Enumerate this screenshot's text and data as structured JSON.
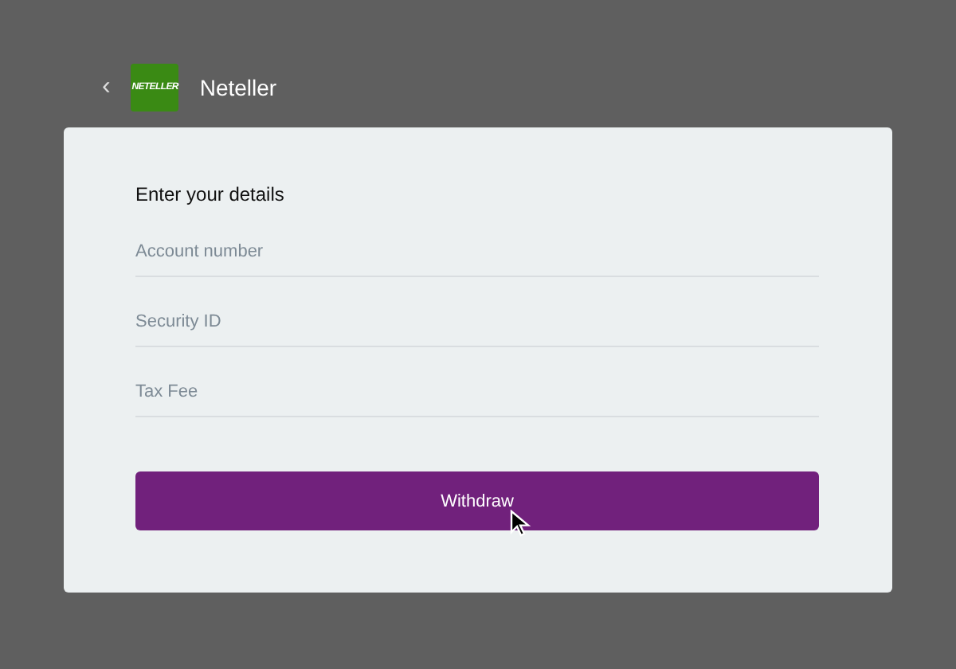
{
  "header": {
    "back": "‹",
    "logo_text": "NETELLER",
    "title": "Neteller"
  },
  "form": {
    "heading": "Enter your details",
    "fields": [
      {
        "placeholder": "Account number"
      },
      {
        "placeholder": "Security ID"
      },
      {
        "placeholder": "Tax Fee"
      }
    ],
    "submit": "Withdraw"
  }
}
